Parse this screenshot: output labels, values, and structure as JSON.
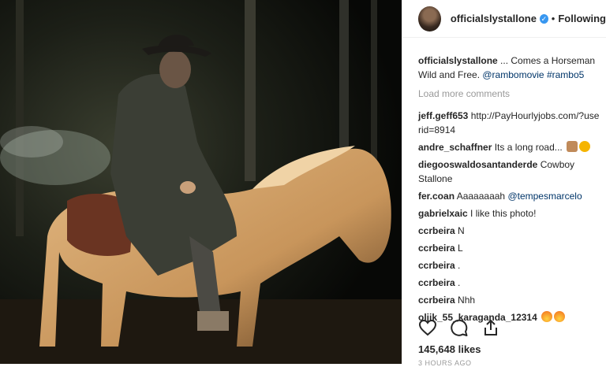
{
  "post": {
    "username": "officialslystallone",
    "separator": "•",
    "follow_label": "Following",
    "caption_user": "officialslystallone",
    "caption_text": " ... Comes a Horseman Wild and Free. ",
    "caption_tag1": "@rambomovie",
    "caption_tag2": "#rambo5",
    "load_more": "Load more comments",
    "likes": "145,648 likes",
    "date": "3 HOURS AGO"
  },
  "comments": [
    {
      "user": "jeff.geff653",
      "text": "http://PayHourlyjobs.com/?userid=8914"
    },
    {
      "user": "andre_schaffner",
      "text": "Its a long road..."
    },
    {
      "user": "diegooswaldosantanderde",
      "text": "Cowboy Stallone"
    },
    {
      "user": "fer.coan",
      "text": "Aaaaaaaah ",
      "tag": "@tempesmarcelo"
    },
    {
      "user": "gabrielxaic",
      "text": "I like this photo!"
    },
    {
      "user": "ccrbeira",
      "text": "N"
    },
    {
      "user": "ccrbeira",
      "text": "L"
    },
    {
      "user": "ccrbeira",
      "text": "."
    },
    {
      "user": "ccrbeira",
      "text": "."
    },
    {
      "user": "ccrbeira",
      "text": "Nhh"
    },
    {
      "user": "oljik_55_karaganda_12314",
      "text": ""
    }
  ],
  "icons": {
    "like": "heart-icon",
    "comment": "comment-icon",
    "share": "share-icon",
    "verified": "verified-badge-icon",
    "avatar": "avatar"
  },
  "colors": {
    "link": "#003569",
    "verified": "#3897f0",
    "muted": "#999999",
    "text": "#262626"
  }
}
